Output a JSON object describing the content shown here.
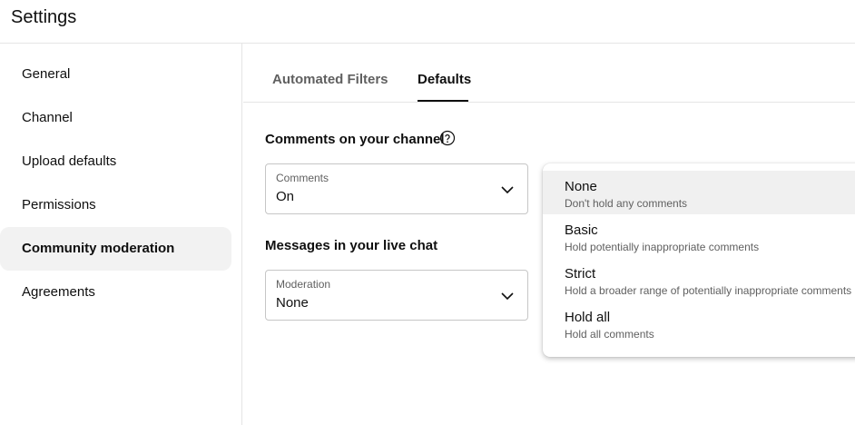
{
  "header": {
    "title": "Settings"
  },
  "sidebar": {
    "items": [
      {
        "label": "General"
      },
      {
        "label": "Channel"
      },
      {
        "label": "Upload defaults"
      },
      {
        "label": "Permissions"
      },
      {
        "label": "Community moderation",
        "active": true
      },
      {
        "label": "Agreements"
      }
    ]
  },
  "tabs": [
    {
      "label": "Automated Filters",
      "active": false
    },
    {
      "label": "Defaults",
      "active": true
    }
  ],
  "comments_section": {
    "title": "Comments on your channel",
    "help_icon": "help-circle-icon",
    "select_label": "Comments",
    "select_value": "On"
  },
  "chat_section": {
    "title": "Messages in your live chat",
    "select_label": "Moderation",
    "select_value": "None"
  },
  "dropdown": {
    "options": [
      {
        "title": "None",
        "desc": "Don't hold any comments",
        "selected": true
      },
      {
        "title": "Basic",
        "desc": "Hold potentially inappropriate comments"
      },
      {
        "title": "Strict",
        "desc": "Hold a broader range of potentially inappropriate comments"
      },
      {
        "title": "Hold all",
        "desc": "Hold all comments"
      }
    ]
  },
  "colors": {
    "text_primary": "#0f0f0f",
    "text_secondary": "#606060",
    "border": "#e5e5e5",
    "active_bg": "#f2f2f2"
  }
}
